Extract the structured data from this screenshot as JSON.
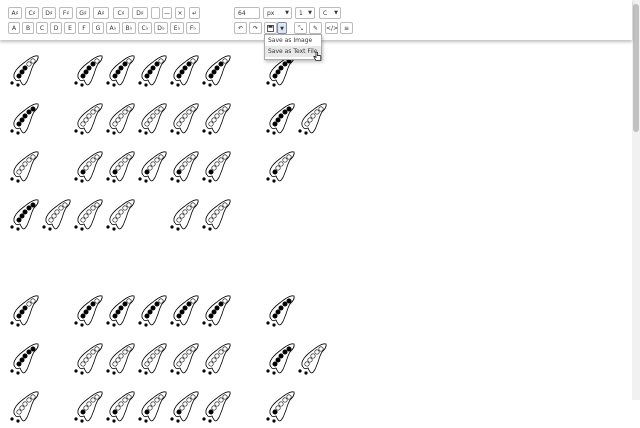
{
  "toolbar": {
    "sharp_keys": [
      "A♯",
      "C♯",
      "D♯",
      "F♯",
      "G♯",
      "A♯",
      "C♯",
      "D♯",
      "",
      "—",
      "×",
      "↵"
    ],
    "flat_keys": [
      "A",
      "B",
      "C",
      "D",
      "E",
      "F",
      "G",
      "A♭",
      "B♭",
      "C♭",
      "D♭",
      "E♭",
      "F♭"
    ],
    "size_value": "64",
    "unit_value": "px",
    "count_value": "1",
    "key_value": "C",
    "icons": [
      "undo-icon",
      "redo-icon",
      "save-icon",
      "dropdown-caret-icon",
      "wand-icon",
      "pencil-icon",
      "code-icon",
      "print-icon"
    ]
  },
  "save_menu": {
    "items": [
      "Save as Image",
      "Save as Text File"
    ],
    "highlighted_index": 1
  },
  "score": {
    "rows": [
      [
        [
          0,
          6
        ],
        [
          2,
          7
        ],
        [
          3,
          7
        ],
        [
          4,
          7
        ],
        [
          5,
          7
        ],
        [
          6,
          7
        ],
        [
          8,
          8
        ]
      ],
      [
        [
          0,
          8
        ],
        [
          2,
          3
        ],
        [
          3,
          3
        ],
        [
          4,
          3
        ],
        [
          5,
          3
        ],
        [
          6,
          3
        ],
        [
          8,
          8
        ],
        [
          9,
          3
        ]
      ],
      [
        [
          0,
          3
        ],
        [
          2,
          4
        ],
        [
          3,
          4
        ],
        [
          4,
          4
        ],
        [
          5,
          4
        ],
        [
          6,
          4
        ],
        [
          8,
          4
        ]
      ],
      [
        [
          0,
          8
        ],
        [
          1,
          3
        ],
        [
          2,
          3
        ],
        [
          3,
          3
        ],
        [
          5,
          3
        ],
        [
          6,
          3
        ]
      ],
      [],
      [],
      [
        [
          0,
          6
        ],
        [
          2,
          7
        ],
        [
          3,
          7
        ],
        [
          4,
          7
        ],
        [
          5,
          7
        ],
        [
          6,
          7
        ],
        [
          8,
          8
        ]
      ],
      [
        [
          0,
          8
        ],
        [
          2,
          3
        ],
        [
          3,
          3
        ],
        [
          4,
          3
        ],
        [
          5,
          3
        ],
        [
          6,
          3
        ],
        [
          8,
          8
        ],
        [
          9,
          3
        ]
      ],
      [
        [
          0,
          3
        ],
        [
          2,
          4
        ],
        [
          3,
          4
        ],
        [
          4,
          4
        ],
        [
          5,
          4
        ],
        [
          6,
          4
        ],
        [
          8,
          4
        ]
      ]
    ]
  }
}
